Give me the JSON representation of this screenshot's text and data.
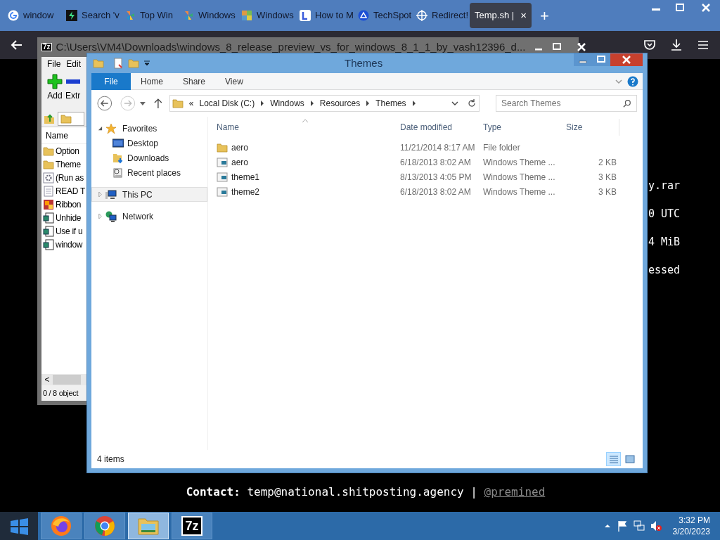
{
  "browser": {
    "tabs": [
      {
        "label": "window",
        "kind": "g",
        "selected": false
      },
      {
        "label": "Search 'v",
        "kind": "bolt",
        "selected": false
      },
      {
        "label": "Top Win",
        "kind": "pinwheel",
        "selected": false
      },
      {
        "label": "Windows",
        "kind": "pinwheel",
        "selected": false
      },
      {
        "label": "Windows",
        "kind": "mosaic",
        "selected": false
      },
      {
        "label": "How to M",
        "kind": "letter",
        "selected": false
      },
      {
        "label": "TechSpot",
        "kind": "triangle",
        "selected": false
      },
      {
        "label": "Redirect!",
        "kind": "cross",
        "selected": false
      },
      {
        "label": "Temp.sh |",
        "kind": "none",
        "selected": true
      }
    ],
    "close_tab": "×",
    "new_tab": "+"
  },
  "page": {
    "terminal_lines": [
      "y.rar",
      "0 UTC",
      "4 MiB",
      "essed"
    ],
    "contact": "**Contact:** temp@national.shitposting.agency |",
    "contact_link": "@premined"
  },
  "sevenzip": {
    "logo": "7z",
    "title": "C:\\Users\\VM4\\Downloads\\windows_8_release_preview_vs_for_windows_8_1_1_by_vash12396_d...",
    "menu": [
      "File",
      "Edit"
    ],
    "toolbar": [
      {
        "label": "Add",
        "kind": "add"
      },
      {
        "label": "Extr",
        "kind": "extract"
      }
    ],
    "column": "Name",
    "items": [
      {
        "name": "Option",
        "kind": "folder"
      },
      {
        "name": "Theme",
        "kind": "folder"
      },
      {
        "name": "(Run as",
        "kind": "gear"
      },
      {
        "name": "READ T",
        "kind": "doc"
      },
      {
        "name": "Ribbon",
        "kind": "ribbon"
      },
      {
        "name": "Unhide",
        "kind": "script"
      },
      {
        "name": "Use if u",
        "kind": "script"
      },
      {
        "name": "window",
        "kind": "script"
      }
    ],
    "scroll_left": "<",
    "status": "0 / 8 object"
  },
  "explorer": {
    "title": "Themes",
    "ribbon_tabs": [
      {
        "label": "File",
        "selected": true
      },
      {
        "label": "Home",
        "selected": false
      },
      {
        "label": "Share",
        "selected": false
      },
      {
        "label": "View",
        "selected": false
      }
    ],
    "breadcrumb": [
      "Local Disk (C:)",
      "Windows",
      "Resources",
      "Themes"
    ],
    "breadcrumb_overflow": "«",
    "search": {
      "placeholder": "Search Themes"
    },
    "nav": [
      {
        "label": "Favorites",
        "kind": "star",
        "expanded": true,
        "selected": false,
        "children": [
          {
            "label": "Desktop",
            "kind": "desktop"
          },
          {
            "label": "Downloads",
            "kind": "downloads"
          },
          {
            "label": "Recent places",
            "kind": "recent"
          }
        ]
      },
      {
        "label": "This PC",
        "kind": "pc",
        "expanded": false,
        "selected": true
      },
      {
        "label": "Network",
        "kind": "network",
        "expanded": false,
        "selected": false
      }
    ],
    "columns": [
      "Name",
      "Date modified",
      "Type",
      "Size"
    ],
    "rows": [
      {
        "name": "aero",
        "kind": "folder",
        "date": "11/21/2014 8:17 AM",
        "type": "File folder"
      },
      {
        "name": "aero",
        "kind": "theme",
        "date": "6/18/2013 8:02 AM",
        "type": "Windows Theme ...",
        "size": "2 KB"
      },
      {
        "name": "theme1",
        "kind": "theme",
        "date": "8/13/2013 4:05 PM",
        "type": "Windows Theme ...",
        "size": "3 KB"
      },
      {
        "name": "theme2",
        "kind": "theme",
        "date": "6/18/2013 8:02 AM",
        "type": "Windows Theme ...",
        "size": "3 KB"
      }
    ],
    "status": "4 items",
    "views": [
      {
        "kind": "details",
        "selected": true
      },
      {
        "kind": "tiles",
        "selected": false
      }
    ]
  },
  "taskbar": {
    "apps": [
      {
        "kind": "firefox",
        "selected": false
      },
      {
        "kind": "chrome",
        "selected": false
      },
      {
        "kind": "explorer",
        "selected": true
      },
      {
        "kind": "sevenzip",
        "selected": false
      }
    ],
    "sevenzip_label": "7z",
    "time": "3:32 PM",
    "date": "3/20/2023"
  }
}
